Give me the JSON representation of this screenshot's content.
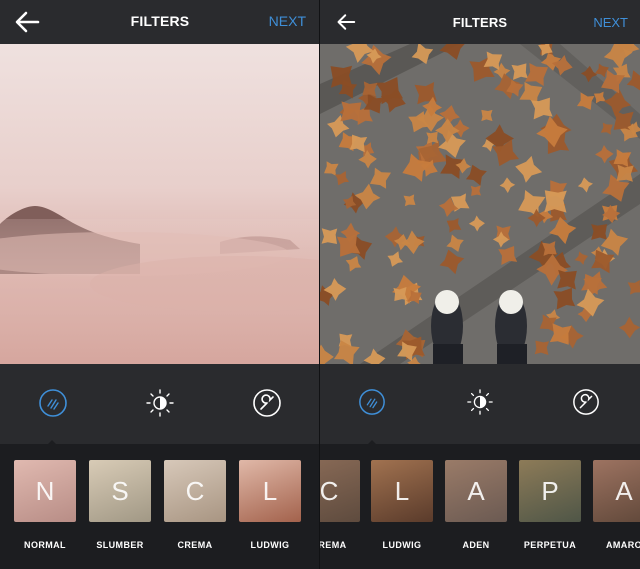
{
  "left_screen": {
    "title": "FILTERS",
    "next_label": "NEXT",
    "filters": [
      {
        "letter": "N",
        "name": "NORMAL",
        "colors": [
          "#e0b9b0",
          "#b88d86"
        ]
      },
      {
        "letter": "S",
        "name": "SLUMBER",
        "colors": [
          "#d8cbb6",
          "#a19885"
        ]
      },
      {
        "letter": "C",
        "name": "CREMA",
        "colors": [
          "#d7c8b9",
          "#a89582"
        ]
      },
      {
        "letter": "L",
        "name": "LUDWIG",
        "colors": [
          "#e0b8a8",
          "#a3624c"
        ]
      }
    ],
    "tools": [
      "lux-icon",
      "brightness-icon",
      "wrench-icon"
    ]
  },
  "right_screen": {
    "title": "FILTERS",
    "next_label": "NEXT",
    "filters": [
      {
        "letter": "C",
        "name": "CREMA",
        "colors": [
          "#8a6b57",
          "#5e4b3e"
        ]
      },
      {
        "letter": "L",
        "name": "LUDWIG",
        "colors": [
          "#a17250",
          "#5a3b2b"
        ]
      },
      {
        "letter": "A",
        "name": "ADEN",
        "colors": [
          "#9a7b68",
          "#6b5a52"
        ]
      },
      {
        "letter": "P",
        "name": "PERPETUA",
        "colors": [
          "#8d7b58",
          "#4f5647"
        ]
      },
      {
        "letter": "A",
        "name": "AMARO",
        "colors": [
          "#9d7361",
          "#5f4739"
        ]
      }
    ],
    "tools": [
      "lux-icon",
      "brightness-icon",
      "wrench-icon"
    ]
  },
  "colors": {
    "accent": "#3f8fd8",
    "bar": "#2a2b2e",
    "strip": "#1c1d20"
  }
}
